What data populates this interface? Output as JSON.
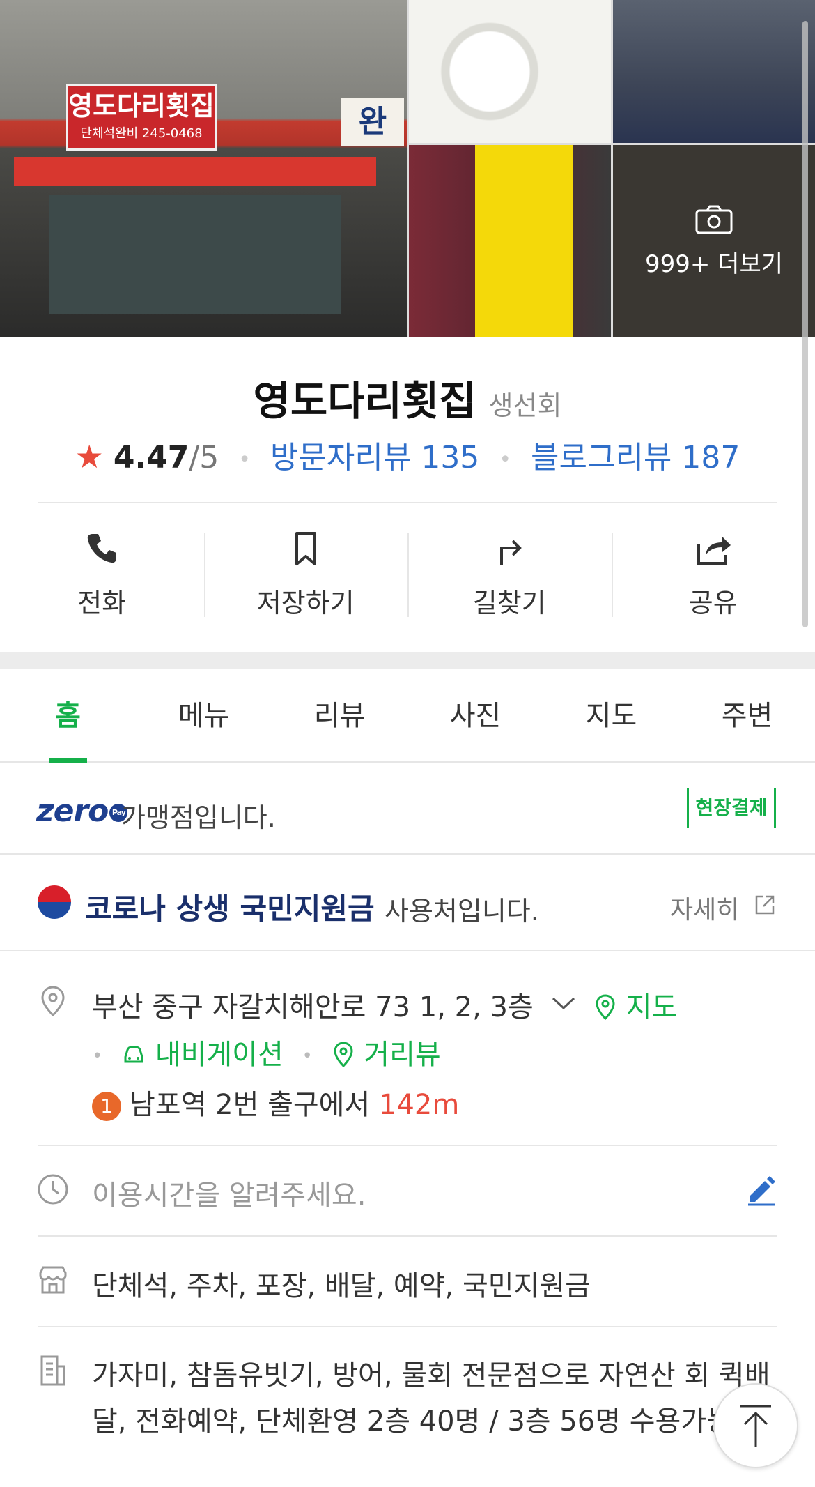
{
  "photos": {
    "main_sign": "영도다리횟집",
    "main_sign_sub": "단체석완비 245-0468",
    "side_sign": "완",
    "more_label": "999+ 더보기"
  },
  "place": {
    "name": "영도다리횟집",
    "category": "생선회",
    "rating": "4.47",
    "rating_max": "/5",
    "visitor_reviews": "방문자리뷰 135",
    "blog_reviews": "블로그리뷰 187"
  },
  "actions": [
    {
      "label": "전화",
      "icon": "phone-icon"
    },
    {
      "label": "저장하기",
      "icon": "bookmark-icon"
    },
    {
      "label": "길찾기",
      "icon": "directions-icon"
    },
    {
      "label": "공유",
      "icon": "share-icon"
    }
  ],
  "tabs": [
    {
      "label": "홈",
      "active": true
    },
    {
      "label": "메뉴"
    },
    {
      "label": "리뷰"
    },
    {
      "label": "사진"
    },
    {
      "label": "지도"
    },
    {
      "label": "주변"
    }
  ],
  "zeropay": {
    "logo": "zero",
    "logo_badge": "Pay",
    "text": "가맹점입니다.",
    "badge": "현장결제"
  },
  "corona": {
    "bold": "코로나 상생 국민지원금",
    "text": "사용처입니다.",
    "detail": "자세히"
  },
  "info": {
    "address": "부산 중구 자갈치해안로 73 1, 2, 3층",
    "map_link": "지도",
    "navigation": "내비게이션",
    "street_view": "거리뷰",
    "station_num": "1",
    "station_text": "남포역 2번 출구에서",
    "station_distance": "142m",
    "hours_prompt": "이용시간을 알려주세요.",
    "amenities": "단체석, 주차, 포장, 배달, 예약, 국민지원금",
    "description": "가자미, 참돔유빗기, 방어, 물회 전문점으로 자연산 회 퀵배달, 전화예약, 단체환영 2층 40명 / 3층 56명 수용가능 !"
  },
  "colors": {
    "accent_green": "#15b04a",
    "link_blue": "#2f6ec9",
    "star_red": "#e84b3c"
  }
}
